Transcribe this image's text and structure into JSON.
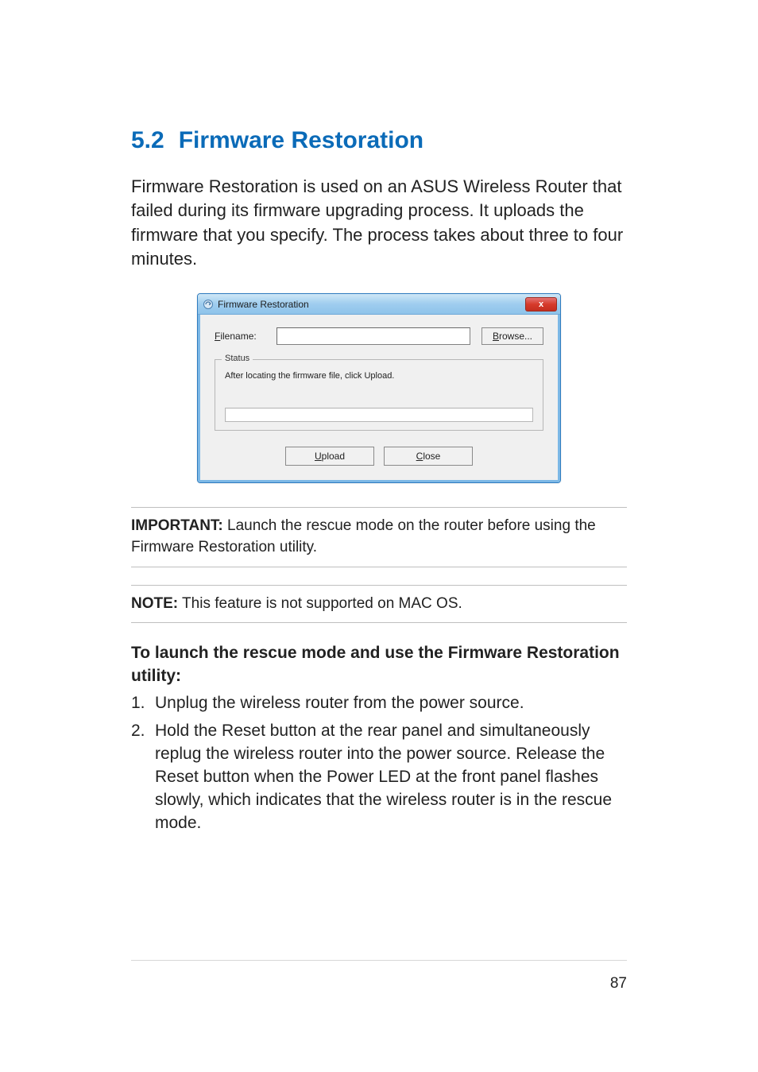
{
  "heading": {
    "number": "5.2",
    "title": "Firmware Restoration"
  },
  "intro": "Firmware Restoration is used on an ASUS Wireless Router that failed during its firmware upgrading process. It uploads the firmware that you specify. The process takes about three to four minutes.",
  "dialog": {
    "title": "Firmware Restoration",
    "close": "x",
    "filename_label_pre": "F",
    "filename_label_post": "ilename:",
    "filename_value": "",
    "browse_pre": "B",
    "browse_post": "rowse...",
    "status_legend": "Status",
    "status_msg": "After locating the firmware file, click Upload.",
    "upload_pre": "U",
    "upload_post": "pload",
    "close_btn_pre": "C",
    "close_btn_post": "lose"
  },
  "important": {
    "label": "IMPORTANT:",
    "text": "  Launch the rescue mode on the router before using the Firmware Restoration utility."
  },
  "note": {
    "label": "NOTE:",
    "text": "  This feature is not supported on MAC OS."
  },
  "sub_heading": "To launch the rescue mode and use the Firmware Restoration utility:",
  "steps": [
    {
      "n": "1.",
      "t": "Unplug the wireless router from the power source."
    },
    {
      "n": "2.",
      "t": "Hold the Reset button at the rear panel and simultaneously replug the wireless router into the power source. Release the Reset button when the Power LED at the front panel flashes slowly, which indicates that the wireless router is in the rescue mode."
    }
  ],
  "page_number": "87"
}
